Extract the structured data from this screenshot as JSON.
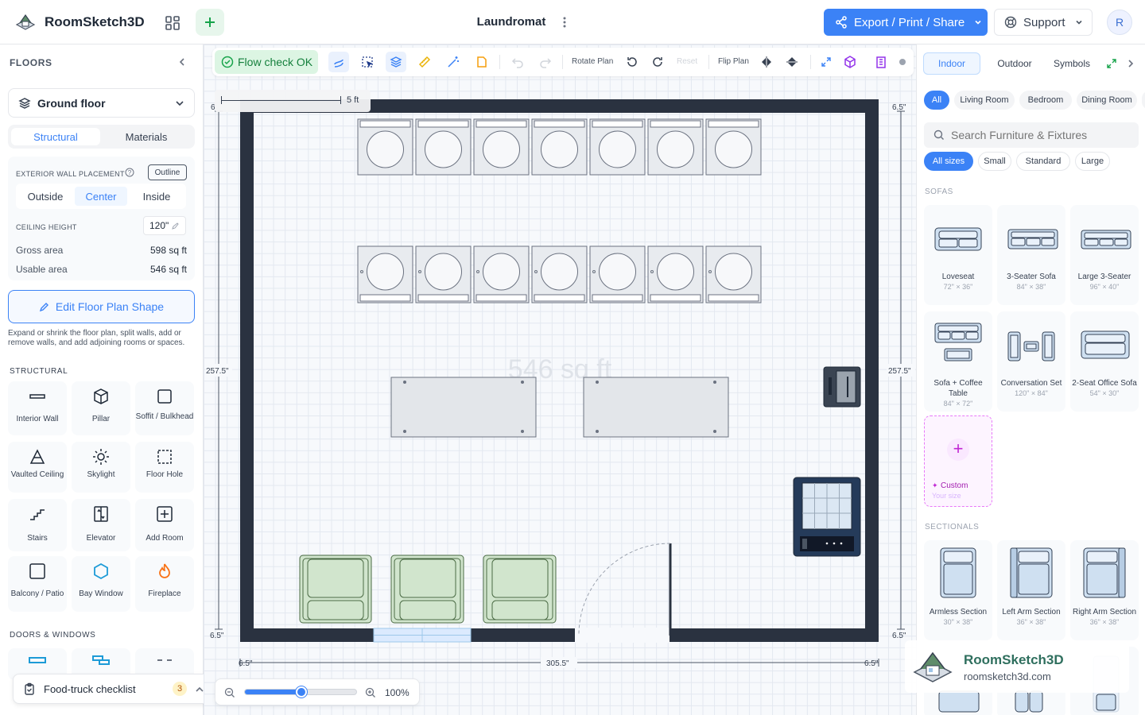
{
  "app": {
    "brand": "RoomSketch3D",
    "title": "Laundromat",
    "avatar": "R"
  },
  "header": {
    "export_label": "Export / Print / Share",
    "support_label": "Support"
  },
  "left": {
    "floors_header": "FLOORS",
    "floor_select": "Ground floor",
    "tabs": [
      "Structural",
      "Materials"
    ],
    "wall_label": "EXTERIOR WALL PLACEMENT",
    "outline_label": "Outline",
    "placement": [
      "Outside",
      "Center",
      "Inside"
    ],
    "ceiling_label": "CEILING HEIGHT",
    "ceiling_value": "120\"",
    "gross_label": "Gross area",
    "gross_value": "598 sq ft",
    "usable_label": "Usable area",
    "usable_value": "546 sq ft",
    "edit_shape": "Edit Floor Plan Shape",
    "edit_help": "Expand or shrink the floor plan, split walls, add or remove walls, and add adjoining rooms or spaces.",
    "structural_header": "STRUCTURAL",
    "structural_items": [
      "Interior Wall",
      "Pillar",
      "Soffit / Bulkhead",
      "Vaulted Ceiling",
      "Skylight",
      "Floor Hole",
      "Stairs",
      "Elevator",
      "Add Room",
      "Balcony / Patio",
      "Bay Window",
      "Fireplace"
    ],
    "doors_header": "DOORS & WINDOWS",
    "checklist_label": "Food-truck checklist",
    "checklist_count": "3"
  },
  "toolbar": {
    "flow_check": "Flow check OK",
    "rotate_label": "Rotate Plan",
    "reset_label": "Reset",
    "flip_label": "Flip Plan"
  },
  "canvas": {
    "scale_label": "5 ft",
    "area_watermark": "546 sq ft",
    "dim_top_left": "6",
    "dim_top_right": "6.5\"",
    "dim_left": "257.5\"",
    "dim_right": "257.5\"",
    "dim_bottom_left": "6.5\"",
    "dim_bottom_right": "6.5\"",
    "dim_width": "305.5\"",
    "dim_bl2": "6.5\"",
    "dim_br2": "6.5\"",
    "zoom": "100%",
    "zoom_fraction": 0.5
  },
  "right": {
    "tabs": [
      "Indoor",
      "Outdoor",
      "Symbols"
    ],
    "rooms": [
      "All",
      "Living Room",
      "Bedroom",
      "Dining Room"
    ],
    "search_placeholder": "Search Furniture & Fixtures",
    "sizes": [
      "All sizes",
      "Small",
      "Standard",
      "Large"
    ],
    "sofas_header": "SOFAS",
    "sofas": [
      {
        "name": "Loveseat",
        "size": "72\" × 36\""
      },
      {
        "name": "3-Seater Sofa",
        "size": "84\" × 38\""
      },
      {
        "name": "Large 3-Seater",
        "size": "96\" × 40\""
      },
      {
        "name": "Sofa + Coffee Table",
        "size": "84\" × 72\""
      },
      {
        "name": "Conversation Set",
        "size": "120\" × 84\""
      },
      {
        "name": "2-Seat Office Sofa",
        "size": "54\" × 30\""
      }
    ],
    "custom_label": "Custom",
    "custom_sub": "Your size",
    "sectionals_header": "SECTIONALS",
    "sectionals": [
      {
        "name": "Armless Section",
        "size": "30\" × 38\""
      },
      {
        "name": "Left Arm Section",
        "size": "36\" × 38\""
      },
      {
        "name": "Right Arm Section",
        "size": "36\" × 38\""
      }
    ],
    "watermark_brand": "RoomSketch3D",
    "watermark_url": "roomsketch3d.com"
  },
  "colors": {
    "accent": "#3b82f6",
    "wall": "#2a3240",
    "success": "#16a34a",
    "custom": "#c026d3"
  }
}
